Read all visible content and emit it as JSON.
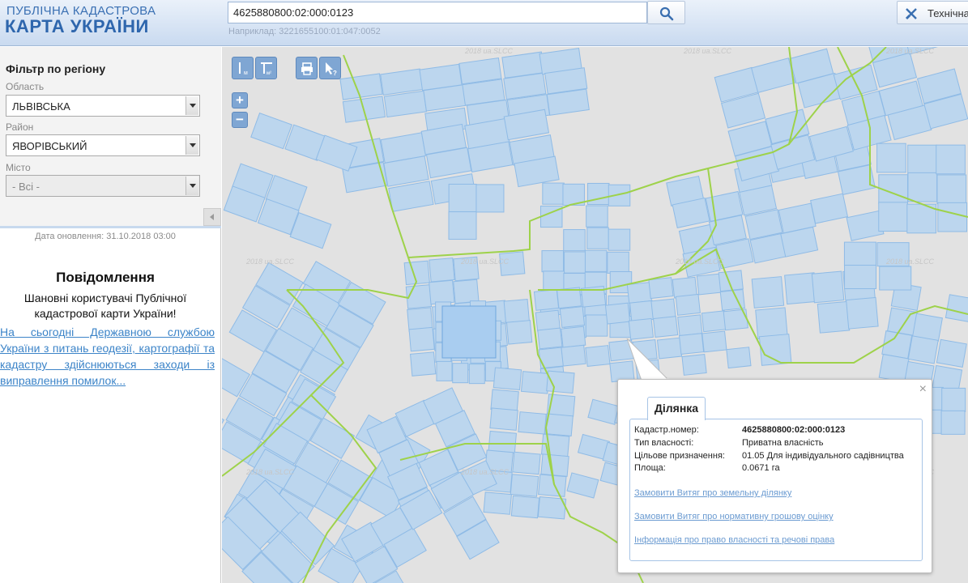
{
  "header": {
    "logo_top": "ПУБЛІЧНА КАДАСТРОВА",
    "logo_bottom": "КАРТА УКРАЇНИ",
    "search_value": "4625880800:02:000:0123",
    "search_hint": "Наприклад: 3221655100:01:047:0052",
    "tech_label": "Технічна"
  },
  "sidebar": {
    "filter_title": "Фільтр по регіону",
    "oblast_label": "Область",
    "oblast_value": "ЛЬВІВСЬКА",
    "raion_label": "Район",
    "raion_value": "ЯВОРІВСЬКИЙ",
    "city_label": "Місто",
    "city_value": "- Всі -",
    "update_date": "Дата оновлення: 31.10.2018 03:00",
    "notice_title": "Повідомлення",
    "notice_body": "Шановні користувачі Публічної кадастрової карти України!",
    "notice_link": "На сьогодні Державною службою України з питань геодезії, картографії та кадастру здійснюються заходи із виправлення помилок..."
  },
  "map": {
    "watermark": "2018 ua.SLCC",
    "zoom_in": "+",
    "zoom_out": "−",
    "colors": {
      "parcel_fill": "#bcd6ee",
      "parcel_stroke": "#8fbbe6",
      "boundary": "#9ed24a",
      "background": "#e2e2e2"
    }
  },
  "popup": {
    "tab": "Ділянка",
    "close": "×",
    "rows": [
      {
        "key": "Кадастр.номер:",
        "value": "4625880800:02:000:0123"
      },
      {
        "key": "Тип власності:",
        "value": "Приватна власність"
      },
      {
        "key": "Цільове призначення:",
        "value": "01.05 Для індивідуального садівництва"
      },
      {
        "key": "Площа:",
        "value": "0.0671 га"
      }
    ],
    "links": [
      "Замовити Витяг про земельну ділянку",
      "Замовити Витяг про нормативну грошову оцінку",
      "Інформація про право власності та речові права"
    ]
  }
}
